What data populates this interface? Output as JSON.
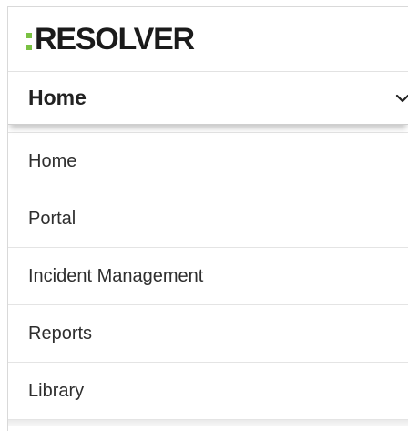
{
  "brand": {
    "name": "RESOLVER",
    "accent_color": "#7ac143"
  },
  "selector": {
    "label": "Home",
    "icon": "chevron-down-icon"
  },
  "menu": {
    "items": [
      {
        "label": "Home"
      },
      {
        "label": "Portal"
      },
      {
        "label": "Incident Management"
      },
      {
        "label": "Reports"
      },
      {
        "label": "Library"
      }
    ]
  }
}
